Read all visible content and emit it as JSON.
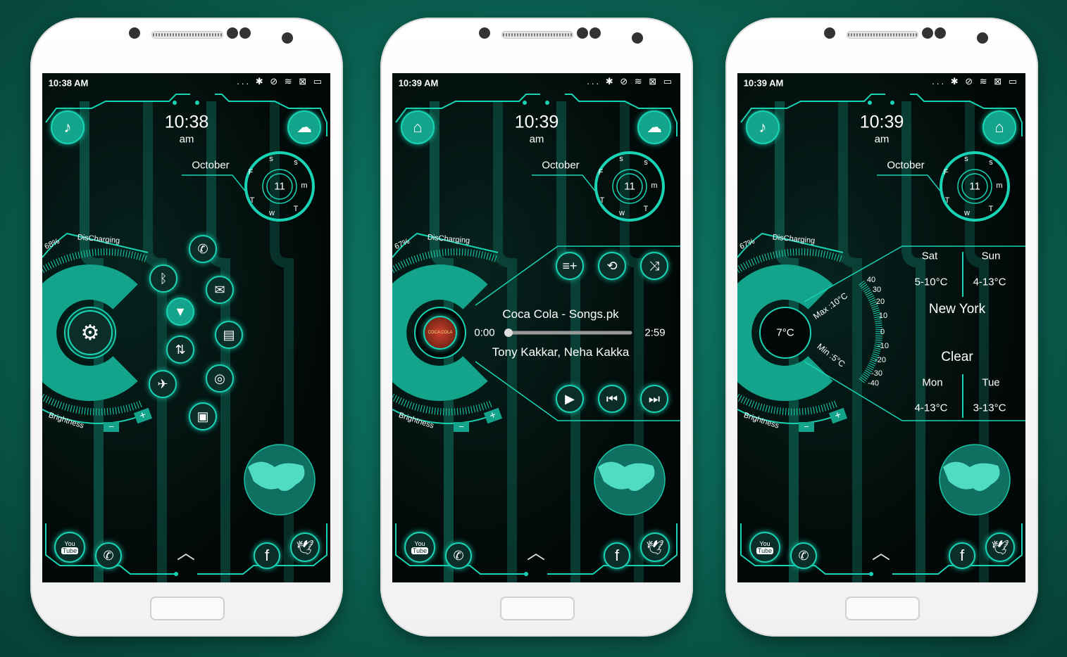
{
  "colors": {
    "accent": "#19d4b4",
    "background": "#0a5f50",
    "screen": "#020807"
  },
  "phones": [
    {
      "status_time": "10:38 AM",
      "status_icons": "... ✱ ⊘ ≋ ⊠ ▭",
      "clock": "10:38",
      "ampm": "am",
      "month": "October",
      "date": "11",
      "weekdays": [
        "s",
        "s",
        "m",
        "T",
        "w",
        "T",
        "F"
      ],
      "battery": "68%",
      "battery_status": "DisCharging",
      "brightness_label": "Brightness",
      "brightness_minus": "−",
      "brightness_plus": "+",
      "left_button_icon": "music-note-icon",
      "right_button_icon": "weather-night-cloud-icon",
      "center_icon": "gear-icon",
      "toggles": [
        "phone-icon",
        "bluetooth-icon",
        "mail-icon",
        "wifi-icon",
        "message-icon",
        "data-transfer-icon",
        "chrome-icon",
        "airplane-icon",
        "briefcase-icon"
      ],
      "dock": {
        "youtube": "You\nTube",
        "youtube_top": "You",
        "youtube_bottom": "Tube",
        "facebook": "f"
      }
    },
    {
      "status_time": "10:39 AM",
      "status_icons": "... ✱ ⊘ ≋ ⊠ ▭",
      "clock": "10:39",
      "ampm": "am",
      "month": "October",
      "date": "11",
      "weekdays": [
        "s",
        "s",
        "m",
        "T",
        "w",
        "T",
        "F"
      ],
      "battery": "67%",
      "battery_status": "DisCharging",
      "brightness_label": "Brightness",
      "brightness_minus": "−",
      "brightness_plus": "+",
      "left_button_icon": "home-icon",
      "right_button_icon": "weather-night-cloud-icon",
      "music": {
        "title": "Coca Cola - Songs.pk",
        "artist": "Tony Kakkar, Neha Kakka",
        "elapsed": "0:00",
        "duration": "2:59",
        "progress": 0,
        "album_art_text": "COCA COLA"
      },
      "dock": {
        "youtube_top": "You",
        "youtube_bottom": "Tube",
        "facebook": "f"
      }
    },
    {
      "status_time": "10:39 AM",
      "status_icons": "... ✱ ⊘ ≋ ⊠ ▭",
      "clock": "10:39",
      "ampm": "am",
      "month": "October",
      "date": "11",
      "weekdays": [
        "s",
        "s",
        "m",
        "T",
        "w",
        "T",
        "F"
      ],
      "battery": "67%",
      "battery_status": "DisCharging",
      "brightness_label": "Brightness",
      "brightness_minus": "−",
      "brightness_plus": "+",
      "left_button_icon": "music-note-icon",
      "right_button_icon": "home-icon",
      "weather": {
        "current": "7°C",
        "max": "Max :10°C",
        "min": "Min :5°C",
        "city": "New York",
        "condition": "Clear",
        "scale": [
          "40",
          "30",
          "20",
          "10",
          "0",
          "-10",
          "-20",
          "-30",
          "-40"
        ],
        "forecast": [
          {
            "day": "Sat",
            "range": "5-10°C"
          },
          {
            "day": "Sun",
            "range": "4-13°C"
          },
          {
            "day": "Mon",
            "range": "4-13°C"
          },
          {
            "day": "Tue",
            "range": "3-13°C"
          }
        ]
      },
      "dock": {
        "youtube_top": "You",
        "youtube_bottom": "Tube",
        "facebook": "f"
      }
    }
  ]
}
